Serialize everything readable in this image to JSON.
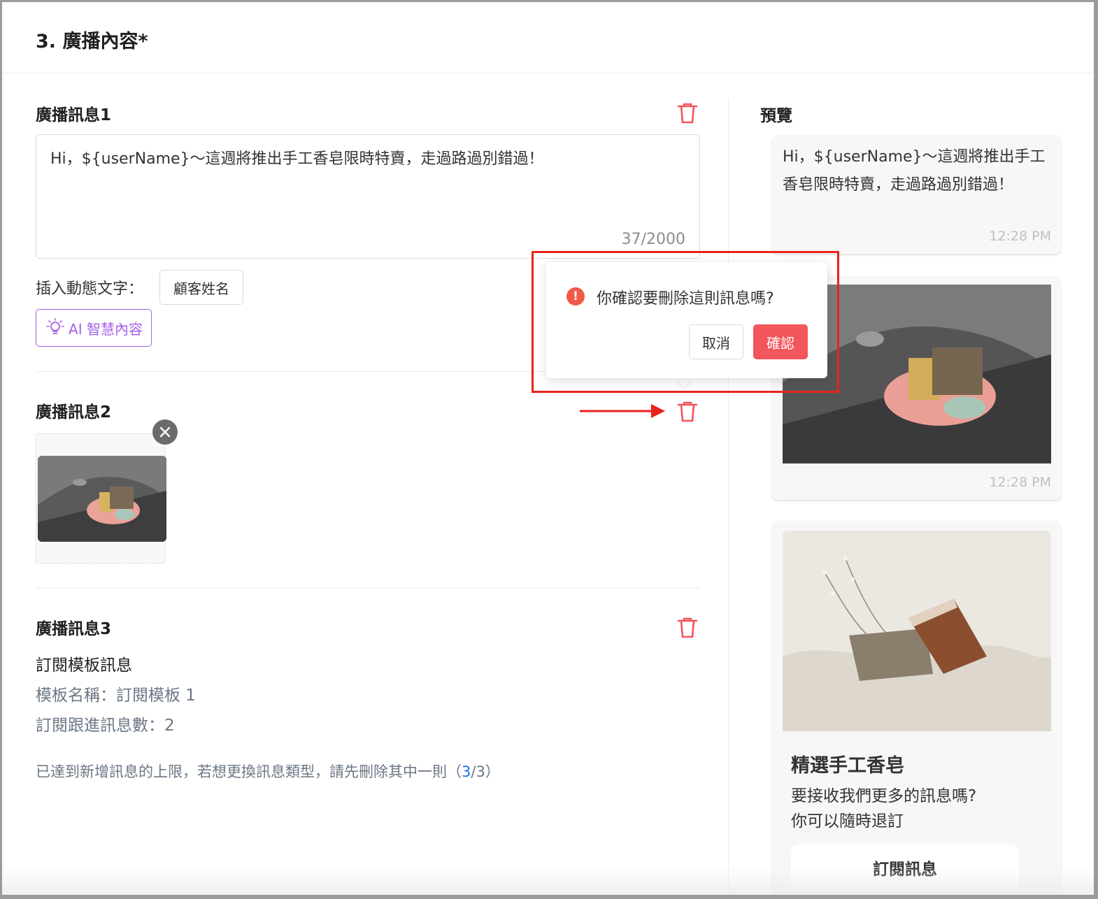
{
  "section": {
    "title": "3. 廣播內容*"
  },
  "message1": {
    "title": "廣播訊息1",
    "text": "Hi，${userName}～這週將推出手工香皂限時特賣，走過路過別錯過！",
    "count": "37/2000",
    "insert_label": "插入動態文字：",
    "tag_customer_name": "顧客姓名",
    "ai_button": "AI 智慧內容"
  },
  "message2": {
    "title": "廣播訊息2"
  },
  "message3": {
    "title": "廣播訊息3",
    "type": "訂閱模板訊息",
    "template_name": "模板名稱：訂閱模板 1",
    "followup_count": "訂閱跟進訊息數：2"
  },
  "limit_note": {
    "prefix": "已達到新增訊息的上限，若想更換訊息類型，請先刪除其中一則（",
    "current": "3",
    "suffix": "/3）"
  },
  "preview": {
    "title": "預覽",
    "text_bubble": {
      "text": "Hi，${userName}～這週將推出手工香皂限時特賣，走過路過別錯過！",
      "time": "12:28 PM"
    },
    "image_bubble": {
      "time": "12:28 PM"
    },
    "card": {
      "title": "精選手工香皂",
      "desc_line1": "要接收我們更多的訊息嗎?",
      "desc_line2": "你可以隨時退訂",
      "button": "訂閱訊息"
    }
  },
  "popconfirm": {
    "message": "你確認要刪除這則訊息嗎?",
    "cancel": "取消",
    "confirm": "確認"
  },
  "colors": {
    "danger": "#f2555a",
    "ai_purple": "#a55eea",
    "link_blue": "#1a73e8",
    "annotation_red": "#e8231d"
  },
  "icons": {
    "delete": "trash-icon",
    "ai": "lightbulb-icon",
    "remove": "close-circle-icon",
    "warning": "exclamation-circle-icon"
  }
}
